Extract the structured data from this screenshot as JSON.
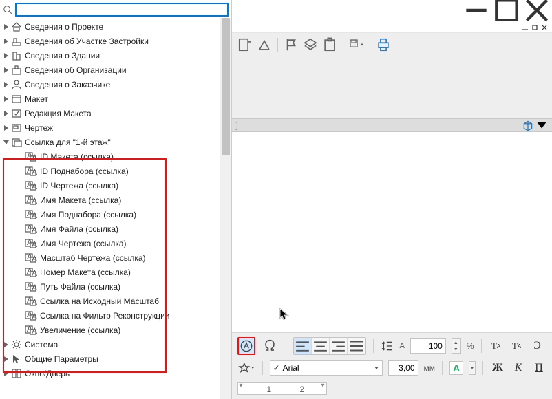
{
  "search": {
    "value": ""
  },
  "tree": {
    "top": [
      {
        "label": "Сведения о Проекте"
      },
      {
        "label": "Сведения об Участке Застройки"
      },
      {
        "label": "Сведения о Здании"
      },
      {
        "label": "Сведения об Организации"
      },
      {
        "label": "Сведения о Заказчике"
      },
      {
        "label": "Макет"
      },
      {
        "label": "Редакция Макета"
      },
      {
        "label": "Чертеж"
      }
    ],
    "expanded": {
      "label": "Ссылка для \"1-й этаж\"",
      "children": [
        {
          "label": "ID Макета (ссылка)."
        },
        {
          "label": "ID Поднабора (ссылка)"
        },
        {
          "label": "ID Чертежа (ссылка)"
        },
        {
          "label": "Имя Макета (ссылка)"
        },
        {
          "label": "Имя Поднабора (ссылка)"
        },
        {
          "label": "Имя Файла (ссылка)"
        },
        {
          "label": "Имя Чертежа (ссылка)"
        },
        {
          "label": "Масштаб Чертежа (ссылка)"
        },
        {
          "label": "Номер Макета (ссылка)"
        },
        {
          "label": "Путь Файла (ссылка)"
        },
        {
          "label": "Ссылка на Исходный Масштаб"
        },
        {
          "label": "Ссылка на Фильтр Реконструкции"
        },
        {
          "label": "Увеличение (ссылка)"
        }
      ]
    },
    "bottom": [
      {
        "label": "Система"
      },
      {
        "label": "Общие Параметры"
      },
      {
        "label": "Окно/Дверь"
      }
    ]
  },
  "tabstub": "]",
  "text_controls": {
    "scale_value": "100",
    "scale_unit": "%",
    "font_name": "Arial",
    "font_size": "3,00",
    "size_unit": "мм",
    "letter_A": "A",
    "bold": "Ж",
    "italic": "К",
    "underline": "П",
    "case_upper": "TA",
    "case_lower": "TA",
    "strike": "Э",
    "ruler": {
      "t1": "1",
      "t2": "2"
    }
  }
}
